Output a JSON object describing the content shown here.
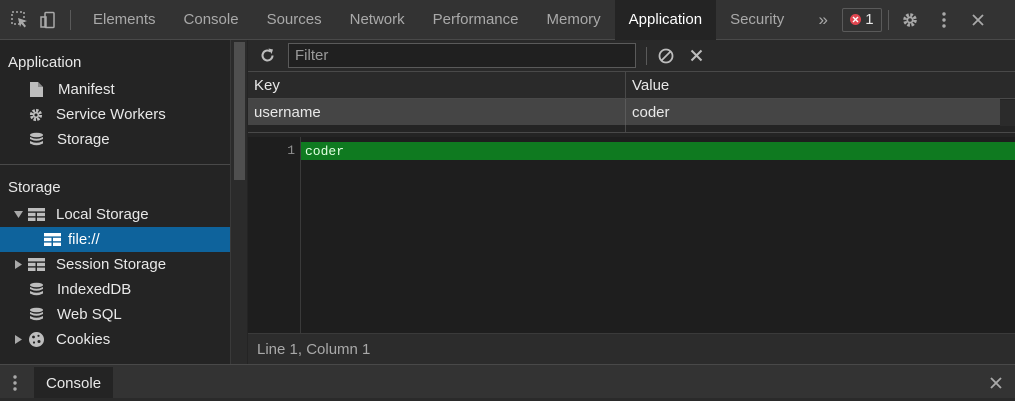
{
  "toolbar": {
    "tabs": [
      {
        "label": "Elements"
      },
      {
        "label": "Console"
      },
      {
        "label": "Sources"
      },
      {
        "label": "Network"
      },
      {
        "label": "Performance"
      },
      {
        "label": "Memory"
      },
      {
        "label": "Application",
        "active": true
      },
      {
        "label": "Security"
      }
    ],
    "error_count": "1",
    "icons": [
      "inspect-icon",
      "device-toggle-icon",
      "more-tabs-icon",
      "error-icon",
      "settings-gear-icon",
      "kebab-menu-icon",
      "close-icon"
    ]
  },
  "sidebar": {
    "application_header": "Application",
    "application_items": [
      {
        "label": "Manifest",
        "icon": "file-icon"
      },
      {
        "label": "Service Workers",
        "icon": "gear-icon"
      },
      {
        "label": "Storage",
        "icon": "database-icon"
      }
    ],
    "storage_header": "Storage",
    "storage_items": [
      {
        "label": "Local Storage",
        "icon": "grid-icon",
        "expanded": true
      },
      {
        "label": "file://",
        "icon": "grid-icon",
        "selected": true
      },
      {
        "label": "Session Storage",
        "icon": "grid-icon",
        "expanded": false
      },
      {
        "label": "IndexedDB",
        "icon": "database-icon"
      },
      {
        "label": "Web SQL",
        "icon": "database-icon"
      },
      {
        "label": "Cookies",
        "icon": "cookie-icon",
        "expanded": false
      }
    ]
  },
  "main": {
    "filter_placeholder": "Filter",
    "columns": {
      "key": "Key",
      "value": "Value"
    },
    "rows": [
      {
        "key": "username",
        "value": "coder"
      }
    ],
    "editor": {
      "line_number": "1",
      "line_text": "coder"
    },
    "status": "Line 1, Column 1"
  },
  "drawer": {
    "tab_label": "Console"
  },
  "colors": {
    "toolbar_bg": "#333333",
    "panel_bg": "#242424",
    "selected_item": "#0e639c",
    "code_highlight": "#0f7a20",
    "error_red": "#e0454f"
  }
}
